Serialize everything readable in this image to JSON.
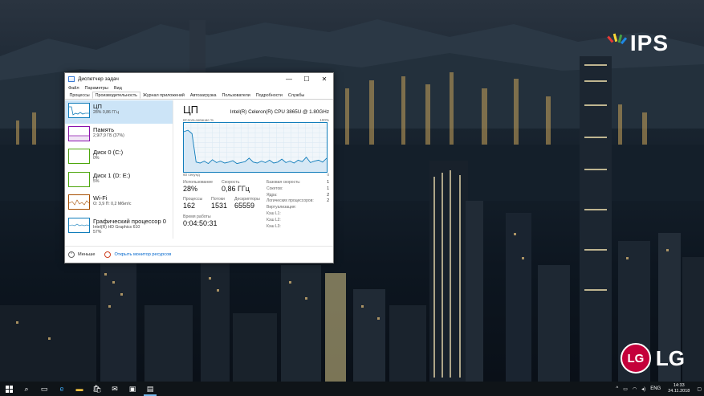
{
  "brand": {
    "ips_text": "IPS",
    "lg_circle": "LG",
    "lg_text": "LG"
  },
  "window": {
    "title": "Диспетчер задач",
    "controls": [
      "—",
      "☐",
      "✕"
    ],
    "menu": [
      "Файл",
      "Параметры",
      "Вид"
    ],
    "tabs": [
      "Процессы",
      "Производительность",
      "Журнал приложений",
      "Автозагрузка",
      "Пользователи",
      "Подробности",
      "Службы"
    ],
    "active_tab": "Производительность"
  },
  "sidebar": {
    "items": [
      {
        "name": "ЦП",
        "sub1": "28% 0,86 ГГц",
        "sub2": "",
        "color": "#117dbb"
      },
      {
        "name": "Память",
        "sub1": "2,9/7,9 ГБ (37%)",
        "sub2": "",
        "color": "#8b12ae"
      },
      {
        "name": "Диск 0 (C:)",
        "sub1": "0%",
        "sub2": "",
        "color": "#4da60c"
      },
      {
        "name": "Диск 1 (D: E:)",
        "sub1": "5%",
        "sub2": "",
        "color": "#4da60c"
      },
      {
        "name": "Wi-Fi",
        "sub1": "О: 3,9 П: 0,2 Мбит/с",
        "sub2": "",
        "color": "#a74f01"
      },
      {
        "name": "Графический процессор 0",
        "sub1": "Intel(R) HD Graphics 610",
        "sub2": "57%",
        "color": "#117dbb"
      }
    ]
  },
  "cpu": {
    "title": "ЦП",
    "model": "Intel(R) Celeron(R) CPU 3865U @ 1.80GHz",
    "graph_label": "Использование %",
    "graph_max": "100%",
    "graph_seconds": "60 секунд",
    "graph_min": "0",
    "usage_trace": [
      82,
      85,
      78,
      20,
      18,
      22,
      17,
      25,
      19,
      22,
      18,
      20,
      23,
      17,
      19,
      21,
      28,
      20,
      18,
      22,
      19,
      24,
      18,
      20,
      26,
      19,
      22,
      18,
      24,
      21,
      30,
      19,
      22,
      24,
      20,
      28
    ],
    "stats": {
      "usage_label": "Использование",
      "usage_value": "28%",
      "speed_label": "Скорость",
      "speed_value": "0,86 ГГц",
      "proc_label": "Процессы",
      "proc_value": "162",
      "threads_label": "Потоки",
      "threads_value": "1531",
      "handles_label": "Дескрипторы",
      "handles_value": "65559",
      "uptime_label": "Время работы",
      "uptime_value": "0:04:50:31"
    },
    "spec": [
      {
        "k": "Базовая скорость:",
        "v": "1"
      },
      {
        "k": "Сокетов:",
        "v": "1"
      },
      {
        "k": "Ядра:",
        "v": "2"
      },
      {
        "k": "Логических процессоров:",
        "v": "2"
      },
      {
        "k": "Виртуализация:",
        "v": ""
      },
      {
        "k": "Кэш L1:",
        "v": ""
      },
      {
        "k": "Кэш L2:",
        "v": ""
      },
      {
        "k": "Кэш L3:",
        "v": ""
      }
    ]
  },
  "footer": {
    "less": "Меньше",
    "monitor_link": "Открыть монитор ресурсов"
  },
  "taskbar": {
    "lang": "ENG",
    "time": "14:33",
    "date": "24.11.2018"
  }
}
